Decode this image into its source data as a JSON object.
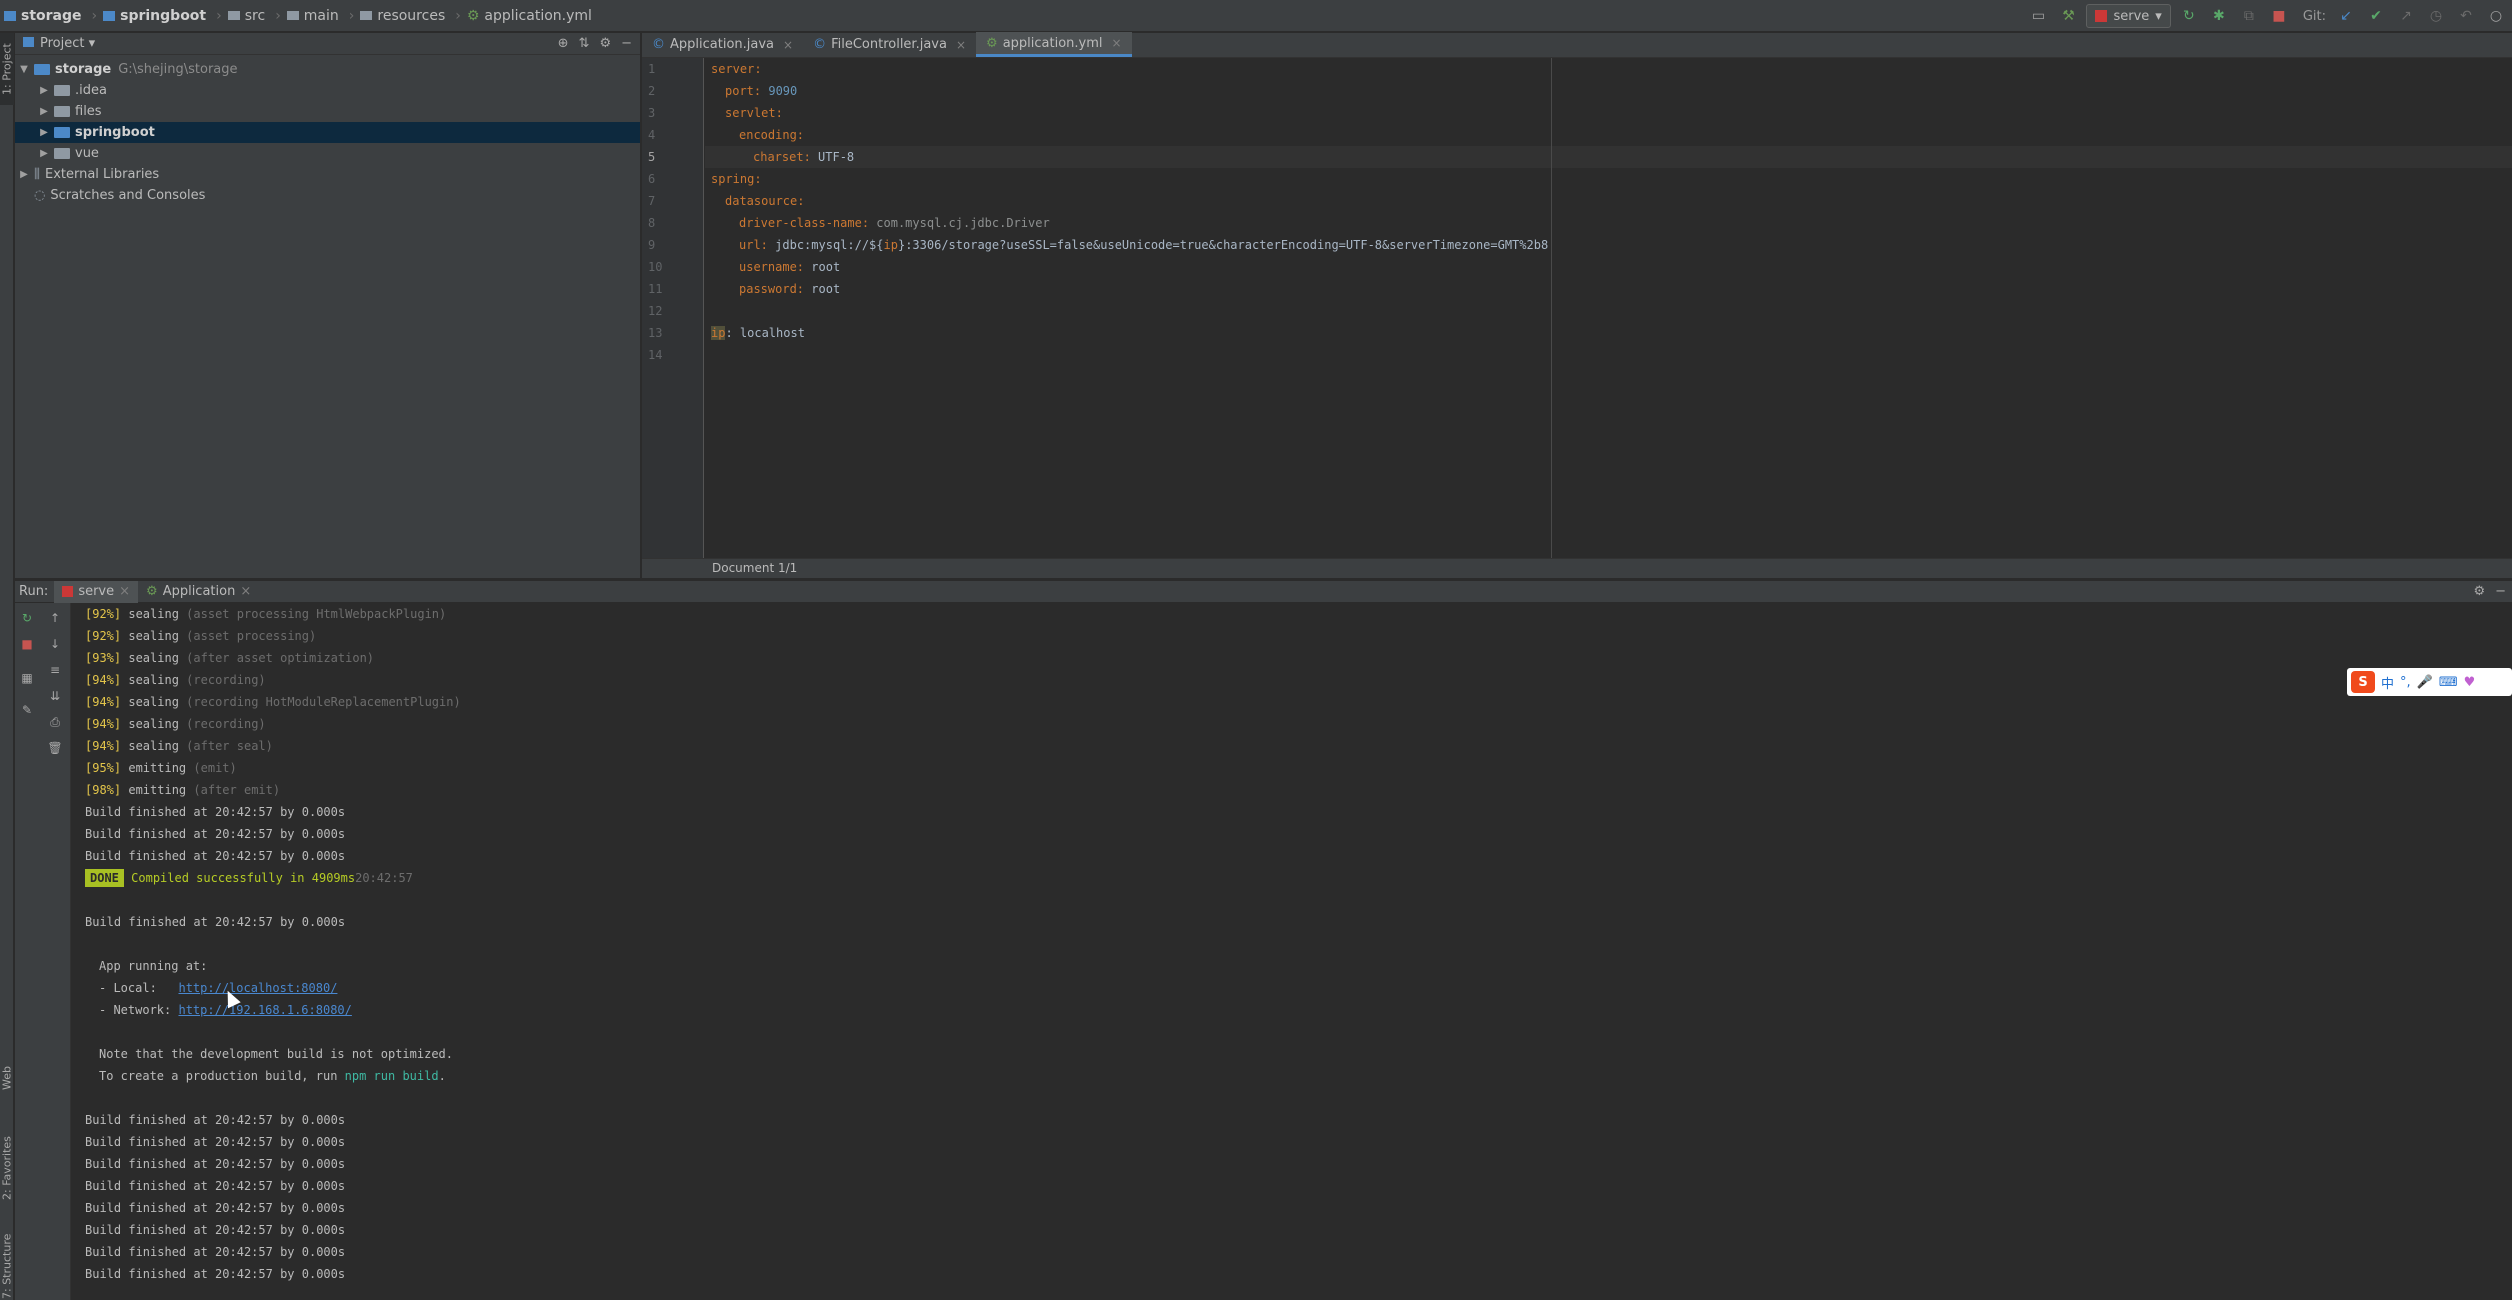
{
  "breadcrumb": [
    "storage",
    "springboot",
    "src",
    "main",
    "resources",
    "application.yml"
  ],
  "toolbar": {
    "run_config": "serve",
    "git_label": "Git:"
  },
  "left_stripe": {
    "project": "1: Project",
    "web": "Web",
    "favorites": "2: Favorites",
    "structure": "7: Structure"
  },
  "project_panel": {
    "title": "Project",
    "root": {
      "name": "storage",
      "path": "G:\\shejing\\storage"
    },
    "items": [
      ".idea",
      "files",
      "springboot",
      "vue"
    ],
    "external": "External Libraries",
    "scratches": "Scratches and Consoles"
  },
  "editor": {
    "tabs": [
      {
        "label": "Application.java"
      },
      {
        "label": "FileController.java"
      },
      {
        "label": "application.yml"
      }
    ],
    "line_numbers": [
      "1",
      "2",
      "3",
      "4",
      "5",
      "6",
      "7",
      "8",
      "9",
      "10",
      "11",
      "12",
      "13",
      "14"
    ],
    "code": {
      "l1": "server:",
      "l2_key": "port:",
      "l2_val": "9090",
      "l3": "servlet:",
      "l4": "encoding:",
      "l5_key": "charset:",
      "l5_val": "UTF-8",
      "l6": "spring:",
      "l7": "datasource:",
      "l8_key": "driver-class-name:",
      "l8_val": "com.mysql.cj.jdbc.Driver",
      "l9_key": "url:",
      "l9_pre": "jdbc:mysql://${",
      "l9_ip": "ip",
      "l9_post": "}:3306/storage?useSSL=false&useUnicode=true&characterEncoding=UTF-8&serverTimezone=GMT%2b8",
      "l10_key": "username:",
      "l10_val": "root",
      "l11_key": "password:",
      "l11_val": "root",
      "l13_key": "ip",
      "l13_val": "localhost"
    },
    "status": "Document 1/1"
  },
  "run": {
    "label": "Run:",
    "tabs": [
      "serve",
      "Application"
    ],
    "console": {
      "progress": [
        {
          "pct": "[92%]",
          "action": "sealing",
          "detail": "(asset processing HtmlWebpackPlugin)"
        },
        {
          "pct": "[92%]",
          "action": "sealing",
          "detail": "(asset processing)"
        },
        {
          "pct": "[93%]",
          "action": "sealing",
          "detail": "(after asset optimization)"
        },
        {
          "pct": "[94%]",
          "action": "sealing",
          "detail": "(recording)"
        },
        {
          "pct": "[94%]",
          "action": "sealing",
          "detail": "(recording HotModuleReplacementPlugin)"
        },
        {
          "pct": "[94%]",
          "action": "sealing",
          "detail": "(recording)"
        },
        {
          "pct": "[94%]",
          "action": "sealing",
          "detail": "(after seal)"
        },
        {
          "pct": "[95%]",
          "action": "emitting",
          "detail": "(emit)"
        },
        {
          "pct": "[98%]",
          "action": "emitting",
          "detail": "(after emit)"
        }
      ],
      "build_line": "Build finished at 20:42:57 by 0.000s",
      "done_badge": "DONE",
      "compiled": "Compiled successfully in 4909ms",
      "compiled_time": "20:42:57",
      "app_running": "App running at:",
      "local_label": "- Local:   ",
      "local_url": "http://localhost:8080/",
      "network_label": "- Network: ",
      "network_url": "http://192.168.1.6:8080/",
      "note1": "Note that the development build is not optimized.",
      "note2_pre": "To create a production build, run ",
      "note2_cmd": "npm run build",
      "note2_post": "."
    }
  },
  "ime": {
    "logo": "S",
    "lang": "中"
  }
}
